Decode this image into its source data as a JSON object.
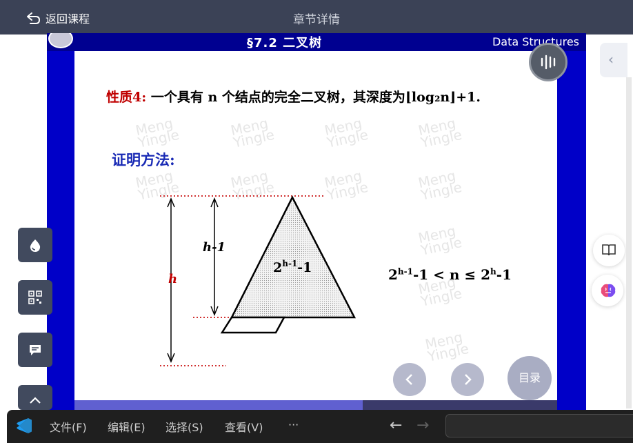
{
  "header": {
    "back_label": "返回课程",
    "title": "章节详情"
  },
  "slide": {
    "section_title": "§7.2 二叉树",
    "course_label": "Data Structures",
    "property_label": "性质4:",
    "property_text": "一个具有 n 个结点的完全二叉树，其深度为⌊log₂n⌋+1.",
    "proof_label": "证明方法:",
    "diagram": {
      "h_label": "h",
      "h_minus_label": "h-1",
      "node_count": "2h-1-1"
    },
    "formula": {
      "left_base": "2",
      "left_exp": "h-1",
      "left_tail": "-1 < n ≤ 2",
      "right_exp": "h",
      "right_tail": "-1"
    },
    "watermark": [
      "Meng",
      "Yingle"
    ]
  },
  "nav": {
    "prev_icon": "chevron-left-icon",
    "next_icon": "chevron-right-icon",
    "toc_label": "目录"
  },
  "vscode": {
    "menus": [
      "文件(F)",
      "编辑(E)",
      "选择(S)",
      "查看(V)",
      "···"
    ],
    "back_arrow": "←",
    "forward_arrow": "→"
  },
  "colors": {
    "header_bg": "#3b4256",
    "slide_frame": "#0000c8",
    "property_red": "#c00000",
    "proof_blue": "#1a2bb5"
  }
}
